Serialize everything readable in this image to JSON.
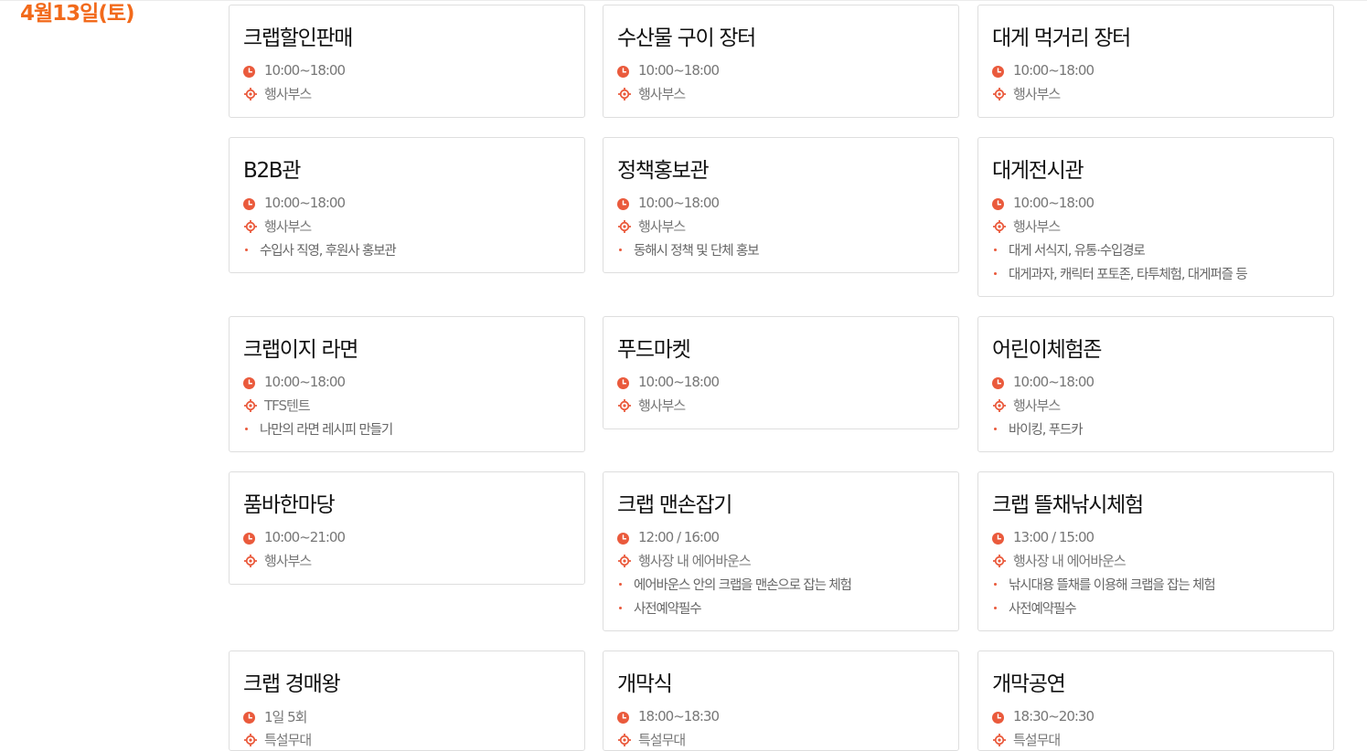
{
  "date_heading": "4월13일(토)",
  "accent_color": "#ea5a3c",
  "heading_color": "#f26a1b",
  "icons": {
    "time": "clock-icon",
    "location": "location-target-icon"
  },
  "events": [
    {
      "title": "크랩할인판매",
      "time": "10:00~18:00",
      "location": "행사부스",
      "details": []
    },
    {
      "title": "수산물 구이 장터",
      "time": "10:00~18:00",
      "location": "행사부스",
      "details": []
    },
    {
      "title": "대게 먹거리 장터",
      "time": "10:00~18:00",
      "location": "행사부스",
      "details": []
    },
    {
      "title": "B2B관",
      "time": "10:00~18:00",
      "location": "행사부스",
      "details": [
        "수입사 직영, 후원사 홍보관"
      ]
    },
    {
      "title": "정책홍보관",
      "time": "10:00~18:00",
      "location": "행사부스",
      "details": [
        "동해시 정책 및 단체 홍보"
      ]
    },
    {
      "title": "대게전시관",
      "time": "10:00~18:00",
      "location": "행사부스",
      "details": [
        "대게 서식지, 유통·수입경로",
        "대게과자, 캐릭터 포토존, 타투체험, 대게퍼즐 등"
      ]
    },
    {
      "title": "크랩이지 라면",
      "time": "10:00~18:00",
      "location": "TFS텐트",
      "details": [
        "나만의 라면 레시피 만들기"
      ]
    },
    {
      "title": "푸드마켓",
      "time": "10:00~18:00",
      "location": "행사부스",
      "details": []
    },
    {
      "title": "어린이체험존",
      "time": "10:00~18:00",
      "location": "행사부스",
      "details": [
        "바이킹, 푸드카"
      ]
    },
    {
      "title": "품바한마당",
      "time": "10:00~21:00",
      "location": "행사부스",
      "details": []
    },
    {
      "title": "크랩 맨손잡기",
      "time": "12:00 / 16:00",
      "location": "행사장 내 에어바운스",
      "details": [
        "에어바운스 안의 크랩을 맨손으로 잡는 체험",
        "사전예약필수"
      ]
    },
    {
      "title": "크랩 뜰채낚시체험",
      "time": "13:00 / 15:00",
      "location": "행사장 내 에어바운스",
      "details": [
        "낚시대용 뜰채를 이용해 크랩을 잡는 체험",
        "사전예약필수"
      ]
    },
    {
      "title": "크랩 경매왕",
      "time": "1일 5회",
      "location": "특설무대",
      "details": []
    },
    {
      "title": "개막식",
      "time": "18:00~18:30",
      "location": "특설무대",
      "details": []
    },
    {
      "title": "개막공연",
      "time": "18:30~20:30",
      "location": "특설무대",
      "details": []
    }
  ]
}
